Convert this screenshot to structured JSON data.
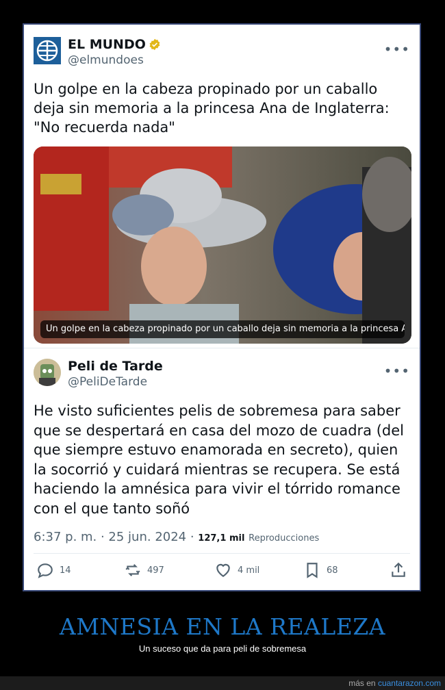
{
  "tweet1": {
    "name": "EL MUNDO",
    "handle": "@elmundoes",
    "more": "•••",
    "text": "Un golpe en la cabeza propinado por un caballo\ndeja sin memoria a la princesa Ana de Inglaterra:\n\"No recuerda nada\"",
    "media_caption": "Un golpe en la cabeza propinado por un caballo deja sin memoria a la princesa Ana de I…"
  },
  "tweet2": {
    "name": "Peli de Tarde",
    "handle": "@PeliDeTarde",
    "more": "•••",
    "text": "He visto suficientes pelis de sobremesa para saber\nque se despertará en casa del mozo de cuadra (del\nque siempre estuvo enamorada en secreto), quien\nla socorrió y cuidará mientras se recupera. Se está\nhaciendo la amnésica para vivir el tórrido romance\ncon el que tanto soñó",
    "timestamp": "6:37 p. m. · 25 jun. 2024 · ",
    "views_count": "127,1 mil",
    "views_label": "Reproducciones"
  },
  "actions": {
    "replies": "14",
    "retweets": "497",
    "likes": "4 mil",
    "bookmarks": "68"
  },
  "icons": [
    "globe-logo-icon",
    "verified-badge-icon",
    "reply-icon",
    "retweet-icon",
    "like-icon",
    "bookmark-icon",
    "share-icon"
  ],
  "colors": {
    "accent_title": "#1e78c8",
    "verified": "#e2b719",
    "link": "#3a8fe0"
  },
  "meme": {
    "title": "AMNESIA EN LA REALEZA",
    "subtitle": "Un suceso que da para peli de sobremesa"
  },
  "footer": {
    "prefix": "más en ",
    "site": "cuantarazon.com"
  }
}
